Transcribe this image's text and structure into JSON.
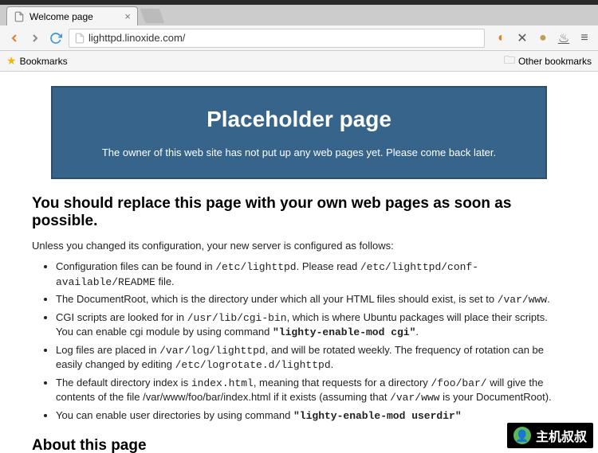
{
  "tab": {
    "title": "Welcome page"
  },
  "url": "lighttpd.linoxide.com/",
  "bookmarks": {
    "left": "Bookmarks",
    "right": "Other bookmarks"
  },
  "banner": {
    "title": "Placeholder page",
    "subtitle": "The owner of this web site has not put up any web pages yet. Please come back later."
  },
  "content": {
    "h2_replace": "You should replace this page with your own web pages as soon as possible.",
    "intro": "Unless you changed its configuration, your new server is configured as follows:",
    "bullets": {
      "b1_a": "Configuration files can be found in ",
      "b1_b": "/etc/lighttpd",
      "b1_c": ". Please read ",
      "b1_d": "/etc/lighttpd/conf-available/README",
      "b1_e": " file.",
      "b2_a": "The DocumentRoot, which is the directory under which all your HTML files should exist, is set to ",
      "b2_b": "/var/www",
      "b2_c": ".",
      "b3_a": "CGI scripts are looked for in ",
      "b3_b": "/usr/lib/cgi-bin",
      "b3_c": ", which is where Ubuntu packages will place their scripts. You can enable cgi module by using command ",
      "b3_d": "\"lighty-enable-mod cgi\"",
      "b3_e": ".",
      "b4_a": "Log files are placed in ",
      "b4_b": "/var/log/lighttpd",
      "b4_c": ", and will be rotated weekly. The frequency of rotation can be easily changed by editing ",
      "b4_d": "/etc/logrotate.d/lighttpd",
      "b4_e": ".",
      "b5_a": "The default directory index is ",
      "b5_b": "index.html",
      "b5_c": ", meaning that requests for a directory ",
      "b5_d": "/foo/bar/",
      "b5_e": " will give the contents of the file /var/www/foo/bar/index.html if it exists (assuming that ",
      "b5_f": "/var/www",
      "b5_g": " is your DocumentRoot).",
      "b6_a": "You can enable user directories by using command ",
      "b6_b": "\"lighty-enable-mod userdir\""
    },
    "h2_about": "About this page"
  },
  "watermark": "主机叔叔"
}
